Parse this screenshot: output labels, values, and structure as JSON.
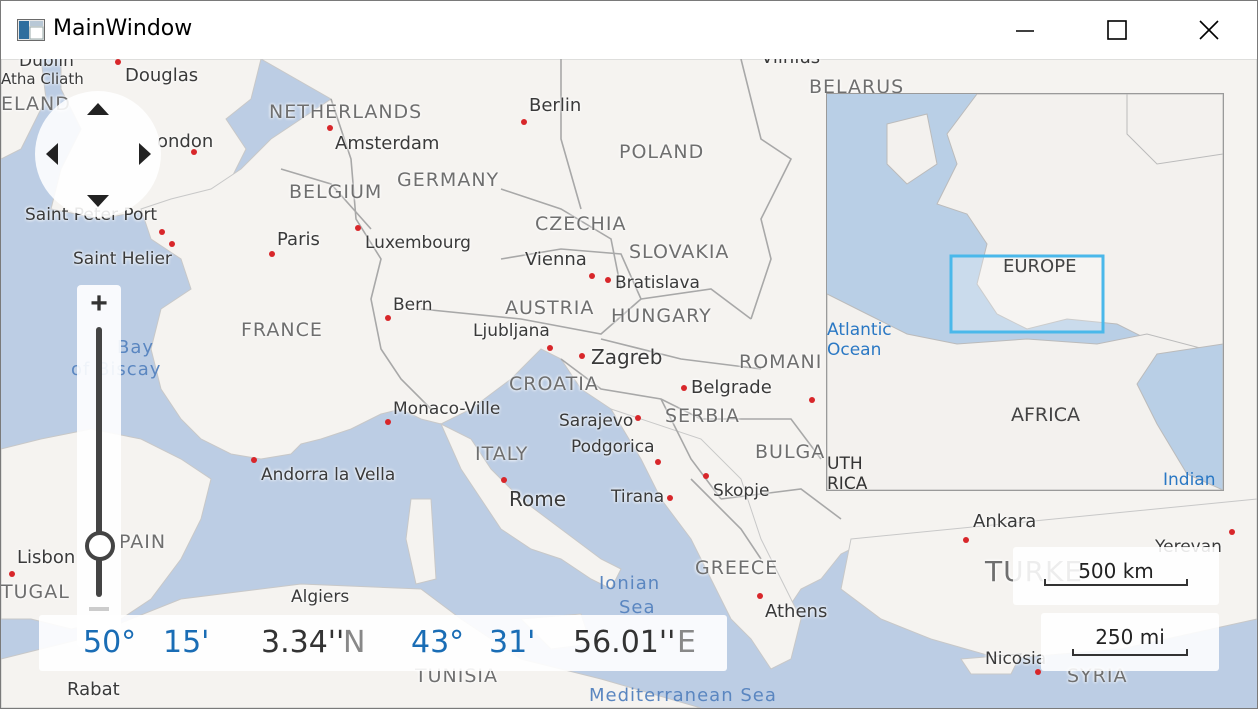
{
  "window": {
    "title": "MainWindow",
    "controls": {
      "minimize": "minimize",
      "maximize": "maximize",
      "close": "close"
    }
  },
  "colors": {
    "water": "#bccde4",
    "land": "#f5f3f0",
    "accent_blue": "#1a6db5",
    "viewport_box": "#4ab8ea"
  },
  "map": {
    "countries": [
      {
        "key": "netherlands",
        "label": "NETHERLANDS"
      },
      {
        "key": "belgium",
        "label": "BELGIUM"
      },
      {
        "key": "germany",
        "label": "GERMANY"
      },
      {
        "key": "poland",
        "label": "POLAND"
      },
      {
        "key": "belarus",
        "label": "BELARUS"
      },
      {
        "key": "czechia",
        "label": "CZECHIA"
      },
      {
        "key": "slovakia",
        "label": "SLOVAKIA"
      },
      {
        "key": "austria",
        "label": "AUSTRIA"
      },
      {
        "key": "hungary",
        "label": "HUNGARY"
      },
      {
        "key": "france",
        "label": "FRANCE"
      },
      {
        "key": "romania",
        "label": "ROMANI"
      },
      {
        "key": "croatia",
        "label": "CROATIA"
      },
      {
        "key": "serbia",
        "label": "SERBIA"
      },
      {
        "key": "bulgaria",
        "label": "BULGAR"
      },
      {
        "key": "italy",
        "label": "ITALY"
      },
      {
        "key": "spain",
        "label": "PAIN"
      },
      {
        "key": "portugal",
        "label": "TUGAL"
      },
      {
        "key": "greece",
        "label": "GREECE"
      },
      {
        "key": "turkey",
        "label": "TURKE"
      },
      {
        "key": "tunisia",
        "label": "TUNISIA"
      },
      {
        "key": "syria",
        "label": "SYRIA"
      },
      {
        "key": "ireland",
        "label": "ELAND"
      }
    ],
    "cities": [
      {
        "key": "dublin",
        "label": "Dublin"
      },
      {
        "key": "baile_atha_cliath",
        "label": "Atha Cliath"
      },
      {
        "key": "douglas",
        "label": "Douglas"
      },
      {
        "key": "london",
        "label": "ondon"
      },
      {
        "key": "amsterdam",
        "label": "Amsterdam"
      },
      {
        "key": "berlin",
        "label": "Berlin"
      },
      {
        "key": "saint_peter_port",
        "label": "Saint Peter Port"
      },
      {
        "key": "saint_helier",
        "label": "Saint Helier"
      },
      {
        "key": "paris",
        "label": "Paris"
      },
      {
        "key": "luxembourg",
        "label": "Luxembourg"
      },
      {
        "key": "vienna",
        "label": "Vienna"
      },
      {
        "key": "bratislava",
        "label": "Bratislava"
      },
      {
        "key": "bern",
        "label": "Bern"
      },
      {
        "key": "ljubljana",
        "label": "Ljubljana"
      },
      {
        "key": "zagreb",
        "label": "Zagreb"
      },
      {
        "key": "belgrade",
        "label": "Belgrade"
      },
      {
        "key": "monaco",
        "label": "Monaco-Ville"
      },
      {
        "key": "sarajevo",
        "label": "Sarajevo"
      },
      {
        "key": "podgorica",
        "label": "Podgorica"
      },
      {
        "key": "andorra",
        "label": "Andorra la Vella"
      },
      {
        "key": "rome",
        "label": "Rome"
      },
      {
        "key": "tirana",
        "label": "Tirana"
      },
      {
        "key": "skopje",
        "label": "Skopje"
      },
      {
        "key": "lisbon",
        "label": "Lisbon"
      },
      {
        "key": "algiers",
        "label": "Algiers"
      },
      {
        "key": "athens",
        "label": "Athens"
      },
      {
        "key": "ankara",
        "label": "Ankara"
      },
      {
        "key": "yerevan",
        "label": "Yerevan"
      },
      {
        "key": "nicosia",
        "label": "Nicosia"
      },
      {
        "key": "rabat",
        "label": "Rabat"
      },
      {
        "key": "vilnius",
        "label": "Vilnius"
      }
    ],
    "water": [
      {
        "key": "bay_of_biscay_1",
        "label": "Bay"
      },
      {
        "key": "bay_of_biscay_2",
        "label": "of Biscay"
      },
      {
        "key": "ionian_1",
        "label": "Ionian"
      },
      {
        "key": "ionian_2",
        "label": "Sea"
      },
      {
        "key": "mediterranean",
        "label": "Mediterranean Sea"
      }
    ]
  },
  "minimap": {
    "labels": {
      "europe": "EUROPE",
      "africa": "AFRICA",
      "atlantic_1": "Atlantic",
      "atlantic_2": "Ocean",
      "south": "UTH",
      "south2": "RICA",
      "indian": "Indian"
    }
  },
  "navigation": {
    "pan_up": "pan up",
    "pan_down": "pan down",
    "pan_left": "pan left",
    "pan_right": "pan right",
    "zoom_in_label": "+",
    "zoom_level": 0.1
  },
  "coordinates": {
    "lat_deg": "50°",
    "lat_min": "15'",
    "lat_sec": "3.34''",
    "lat_hem": "N",
    "lon_deg": "43°",
    "lon_min": "31'",
    "lon_sec": "56.01''",
    "lon_hem": "E"
  },
  "scale": {
    "km": "500 km",
    "mi": "250 mi"
  }
}
